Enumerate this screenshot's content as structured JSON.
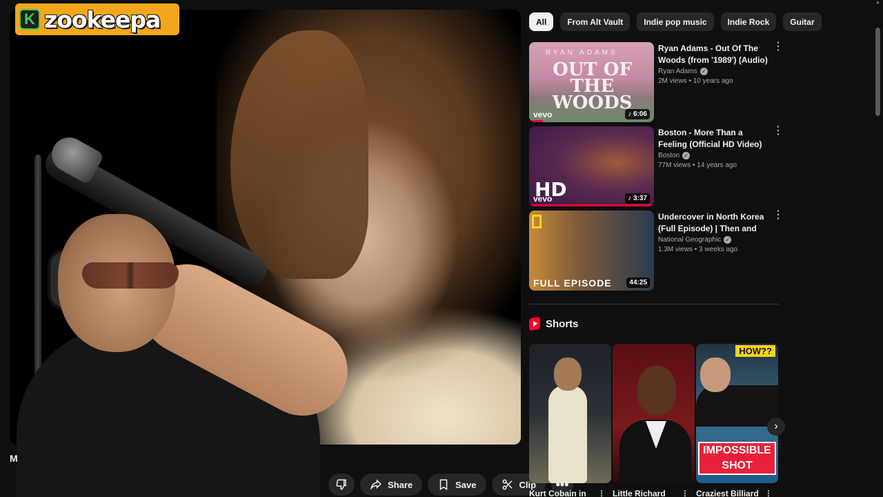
{
  "watermark": {
    "text": "zookeepa",
    "badge": "K"
  },
  "video": {
    "title_fragment": "M"
  },
  "actions": [
    {
      "label": "",
      "icon": "dislike-icon"
    },
    {
      "label": "Share",
      "icon": "share-icon"
    },
    {
      "label": "Save",
      "icon": "bookmark-icon"
    },
    {
      "label": "Clip",
      "icon": "scissors-icon"
    }
  ],
  "chips": [
    "All",
    "From Alt Vault",
    "Indie pop music",
    "Indie Rock",
    "Guitar"
  ],
  "recommendations": [
    {
      "title": "Ryan Adams - Out Of The Woods (from '1989') (Audio)",
      "channel": "Ryan Adams",
      "stats": "2M views • 10 years ago",
      "duration": "♪ 6:06",
      "thumb_top": "RYAN ADAMS",
      "thumb_text": "OUT OF THE WOODS",
      "thumb_badge": "vevo"
    },
    {
      "title": "Boston - More Than a Feeling (Official HD Video)",
      "channel": "Boston",
      "stats": "77M views • 14 years ago",
      "duration": "♪ 3:37",
      "thumb_text": "HD",
      "thumb_badge": "vevo"
    },
    {
      "title": "Undercover in North Korea (Full Episode) | Then and Now with Li...",
      "channel": "National Geographic",
      "stats": "1.3M views • 3 weeks ago",
      "duration": "44:25",
      "thumb_text": "FULL EPISODE"
    }
  ],
  "shorts": {
    "heading": "Shorts",
    "items": [
      {
        "title": "Kurt Cobain in"
      },
      {
        "title": "Little Richard"
      },
      {
        "title": "Craziest Billiard",
        "badge_top": "HOW??",
        "badge_bottom": "IMPOSSIBLE SHOT"
      }
    ]
  },
  "colors": {
    "background": "#0f0f0f",
    "chip_active": "#f1f1f1",
    "accent_red": "#ff0033",
    "watermark": "#f2a71b"
  }
}
